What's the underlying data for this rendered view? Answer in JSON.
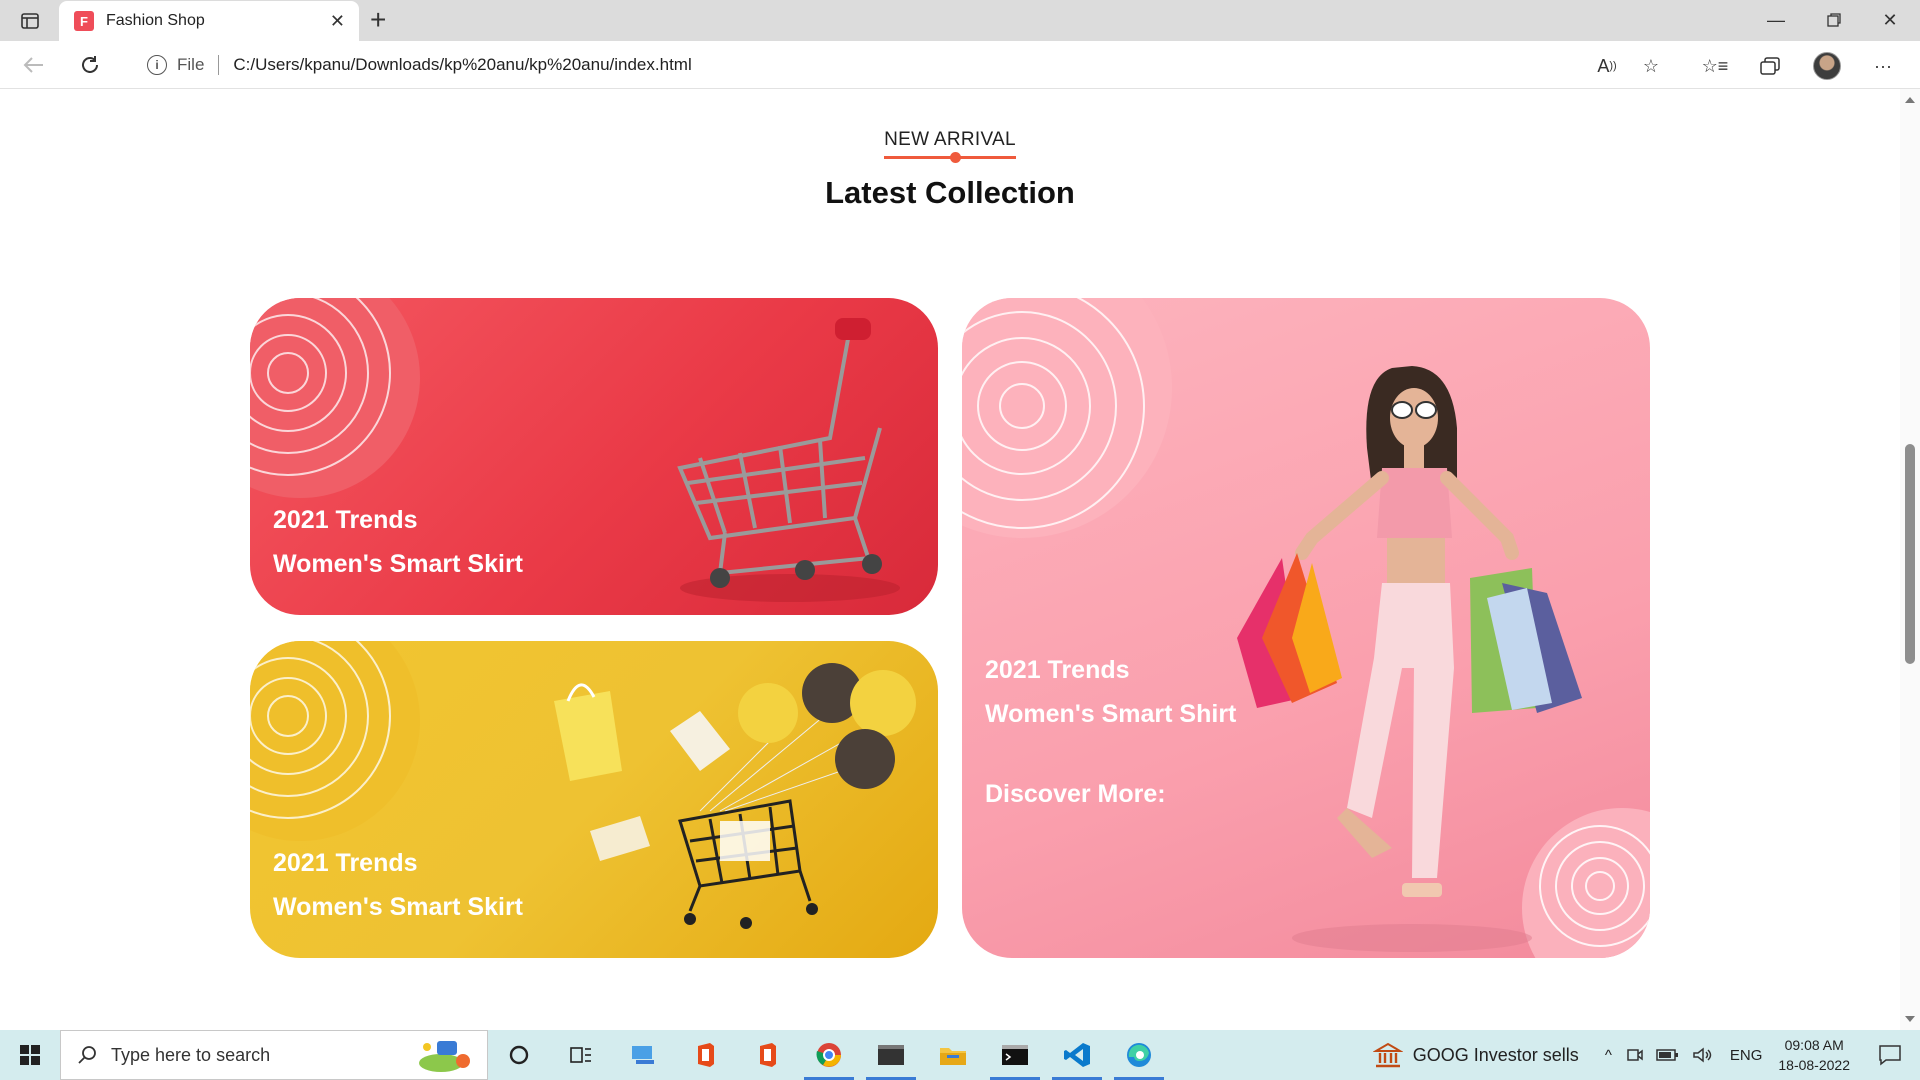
{
  "browser": {
    "tab_title": "Fashion Shop",
    "tab_favicon_letter": "F",
    "address_prefix": "File",
    "url": "C:/Users/kpanu/Downloads/kp%20anu/kp%20anu/index.html"
  },
  "section": {
    "eyebrow": "NEW ARRIVAL",
    "title": "Latest Collection"
  },
  "cards": [
    {
      "line1": "2021 Trends",
      "line2": "Women's Smart Skirt",
      "theme": "#ea3a47"
    },
    {
      "line1": "2021 Trends",
      "line2": "Women's Smart Skirt",
      "theme": "#eec232"
    },
    {
      "line1": "2021 Trends",
      "line2": "Women's Smart Shirt",
      "cta": "Discover More:",
      "theme": "#fa9fad"
    }
  ],
  "taskbar": {
    "search_placeholder": "Type here to search",
    "news": "GOOG  Investor sells",
    "lang": "ENG",
    "time": "09:08 AM",
    "date": "18-08-2022",
    "apps": [
      "cortana-icon",
      "task-view-icon",
      "computer-icon",
      "office-icon",
      "office-icon",
      "chrome-icon",
      "terminal-icon",
      "file-explorer-icon",
      "cmd-icon",
      "vscode-icon",
      "edge-icon"
    ]
  }
}
